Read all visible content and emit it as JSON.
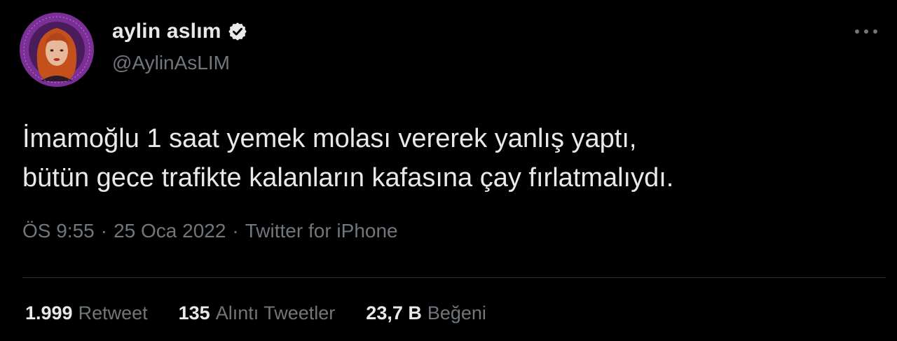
{
  "author": {
    "display_name": "aylin aslım",
    "handle": "@AylinAsLIM",
    "verified": true,
    "avatar_ring_color": "#7b2f97"
  },
  "tweet": {
    "lines": [
      "İmamoğlu 1 saat yemek molası vererek yanlış yaptı,",
      "bütün gece trafikte kalanların kafasına çay fırlatmalıydı."
    ]
  },
  "meta": {
    "time": "ÖS 9:55",
    "separator": "·",
    "date": "25 Oca 2022",
    "source": "Twitter for iPhone"
  },
  "stats": {
    "retweets": {
      "count": "1.999",
      "label": "Retweet"
    },
    "quotes": {
      "count": "135",
      "label": "Alıntı Tweetler"
    },
    "likes": {
      "count": "23,7 B",
      "label": "Beğeni"
    }
  },
  "colors": {
    "background": "#000000",
    "primary_text": "#e7e9ea",
    "secondary_text": "#71767b",
    "divider": "#2f3336"
  },
  "icons": {
    "verified": "verified-badge-icon",
    "more": "more-horizontal-icon"
  }
}
